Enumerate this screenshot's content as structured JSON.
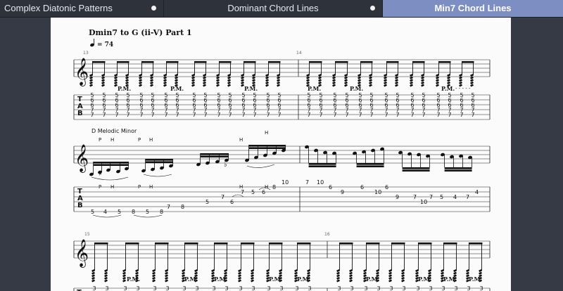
{
  "tabs": [
    {
      "label": "Complex Diatonic Patterns",
      "active": false
    },
    {
      "label": "Dominant Chord Lines",
      "active": false
    },
    {
      "label": "Min7 Chord Lines",
      "active": true
    }
  ],
  "score": {
    "title": "Dmin7 to G (ii-V) Part 1",
    "tempo": "= 74",
    "measure_numbers": [
      "13",
      "14",
      "15",
      "16"
    ],
    "palm_mute": "P.M.",
    "hammer": "H",
    "pull": "P",
    "scale_text": "D Melodic Minor",
    "tab_letters": [
      "T",
      "A",
      "B"
    ],
    "chord_frets_sys1": [
      "5",
      "6",
      "6",
      "7",
      "7"
    ],
    "fret3": "3",
    "lick": [
      "5",
      "4",
      "5",
      "8",
      "5",
      "8",
      "7",
      "8",
      "5",
      "7",
      "6",
      "7",
      "5",
      "6",
      "8",
      "10",
      "7",
      "10",
      "6",
      "9",
      "6",
      "10",
      "6",
      "9",
      "7",
      "10",
      "7",
      "5",
      "4",
      "7",
      "4"
    ],
    "dots_label": "- - - - -"
  },
  "colors": {
    "active_tab": "#7d8fc2",
    "tabbar": "#2d323b",
    "page": "#fbfbfb"
  }
}
